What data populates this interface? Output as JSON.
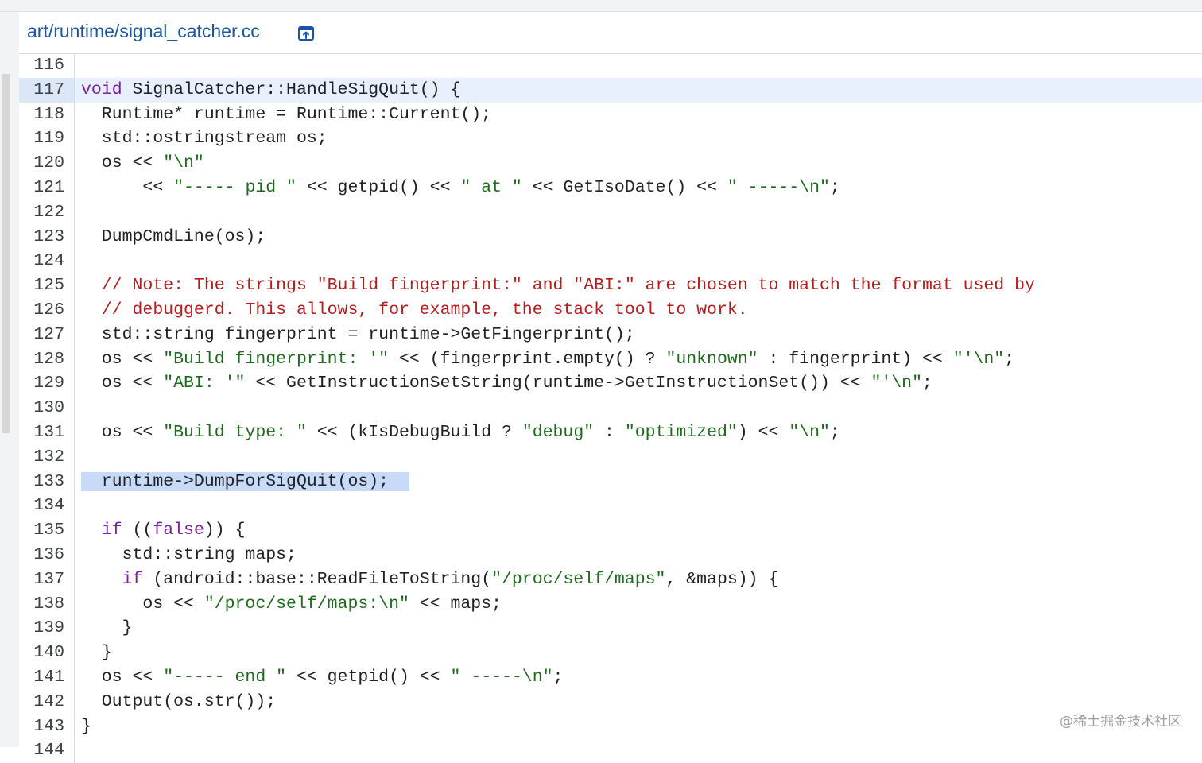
{
  "file": {
    "path": "art/runtime/signal_catcher.cc",
    "open_icon": "open-in-new-icon"
  },
  "code": {
    "highlighted_line": "117",
    "selected_line": "133",
    "lines": [
      {
        "n": "116",
        "t": ""
      },
      {
        "n": "117",
        "t": "void SignalCatcher::HandleSigQuit() {"
      },
      {
        "n": "118",
        "t": "  Runtime* runtime = Runtime::Current();"
      },
      {
        "n": "119",
        "t": "  std::ostringstream os;"
      },
      {
        "n": "120",
        "t": "  os << \"\\n\""
      },
      {
        "n": "121",
        "t": "      << \"----- pid \" << getpid() << \" at \" << GetIsoDate() << \" -----\\n\";"
      },
      {
        "n": "122",
        "t": ""
      },
      {
        "n": "123",
        "t": "  DumpCmdLine(os);"
      },
      {
        "n": "124",
        "t": ""
      },
      {
        "n": "125",
        "t": "  // Note: The strings \"Build fingerprint:\" and \"ABI:\" are chosen to match the format used by"
      },
      {
        "n": "126",
        "t": "  // debuggerd. This allows, for example, the stack tool to work."
      },
      {
        "n": "127",
        "t": "  std::string fingerprint = runtime->GetFingerprint();"
      },
      {
        "n": "128",
        "t": "  os << \"Build fingerprint: '\" << (fingerprint.empty() ? \"unknown\" : fingerprint) << \"'\\n\";"
      },
      {
        "n": "129",
        "t": "  os << \"ABI: '\" << GetInstructionSetString(runtime->GetInstructionSet()) << \"'\\n\";"
      },
      {
        "n": "130",
        "t": ""
      },
      {
        "n": "131",
        "t": "  os << \"Build type: \" << (kIsDebugBuild ? \"debug\" : \"optimized\") << \"\\n\";"
      },
      {
        "n": "132",
        "t": ""
      },
      {
        "n": "133",
        "t": "  runtime->DumpForSigQuit(os);"
      },
      {
        "n": "134",
        "t": ""
      },
      {
        "n": "135",
        "t": "  if ((false)) {"
      },
      {
        "n": "136",
        "t": "    std::string maps;"
      },
      {
        "n": "137",
        "t": "    if (android::base::ReadFileToString(\"/proc/self/maps\", &maps)) {"
      },
      {
        "n": "138",
        "t": "      os << \"/proc/self/maps:\\n\" << maps;"
      },
      {
        "n": "139",
        "t": "    }"
      },
      {
        "n": "140",
        "t": "  }"
      },
      {
        "n": "141",
        "t": "  os << \"----- end \" << getpid() << \" -----\\n\";"
      },
      {
        "n": "142",
        "t": "  Output(os.str());"
      },
      {
        "n": "143",
        "t": "}"
      },
      {
        "n": "144",
        "t": ""
      }
    ]
  },
  "watermark": "@稀土掘金技术社区",
  "colors": {
    "keyword": "#7b1fa2",
    "string": "#1e6b1e",
    "comment": "#b71c1c",
    "link": "#1a56a6",
    "line_highlight": "#e8f0fe",
    "selection": "#c7daf7"
  }
}
